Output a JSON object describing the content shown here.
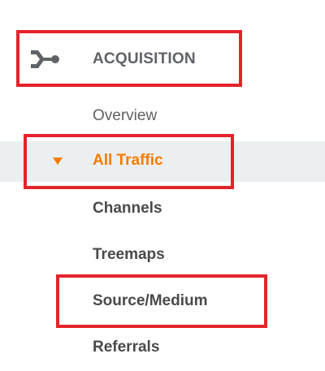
{
  "nav": {
    "section": {
      "label": "ACQUISITION",
      "icon": "acquisition-icon"
    },
    "items": [
      {
        "label": "Overview"
      },
      {
        "label": "All Traffic",
        "expanded": true,
        "accent_color": "#f57c00"
      },
      {
        "label": "Channels"
      },
      {
        "label": "Treemaps"
      },
      {
        "label": "Source/Medium"
      },
      {
        "label": "Referrals"
      }
    ]
  },
  "annotations": {
    "highlight_color": "#e3242b"
  }
}
